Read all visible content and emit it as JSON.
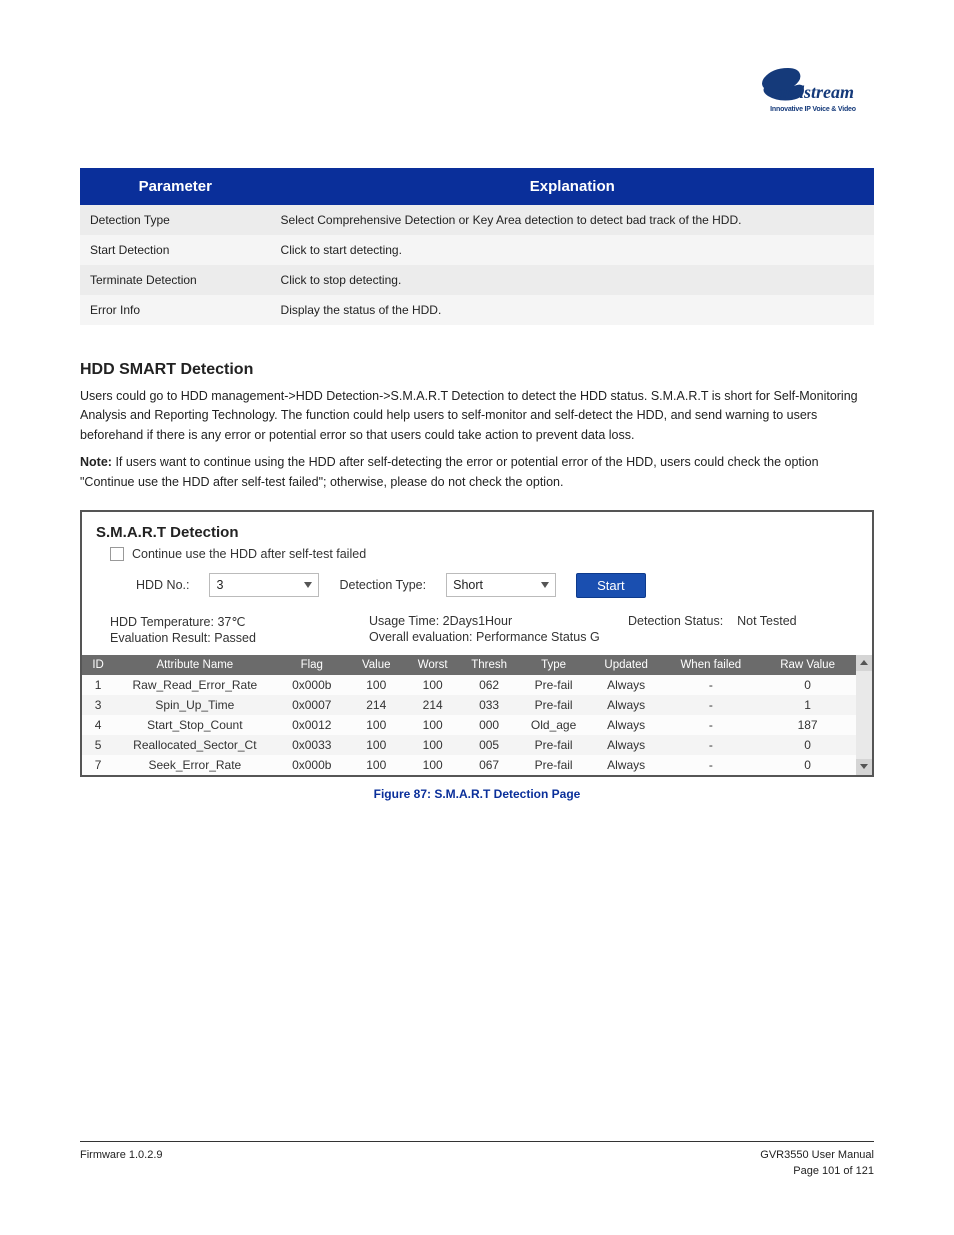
{
  "logo": {
    "tagline": "Innovative IP Voice & Video"
  },
  "param_table": {
    "headers": [
      "Parameter",
      "Explanation"
    ],
    "rows": [
      {
        "param": "Detection Type",
        "explanation": "Select Comprehensive Detection or Key Area detection to detect bad track of the HDD."
      },
      {
        "param": "Start Detection",
        "explanation": "Click to start detecting."
      },
      {
        "param": "Terminate Detection",
        "explanation": "Click to stop detecting."
      },
      {
        "param": "Error Info",
        "explanation": "Display the status of the HDD."
      }
    ]
  },
  "section": {
    "heading": "HDD SMART Detection",
    "paragraph": "Users could go to HDD management->HDD Detection->S.M.A.R.T Detection to detect the HDD status. S.M.A.R.T is short for Self-Monitoring Analysis and Reporting Technology. The function could help users to self-monitor and self-detect the HDD, and send warning to users beforehand if there is any error or potential error so that users could take action to prevent data loss.",
    "note_label": "Note:",
    "note_text": " If users want to continue using the HDD after self-detecting the error or potential error of the HDD, users could check the option \"Continue use the HDD after self-test failed\"; otherwise, please do not check the option."
  },
  "figure": {
    "title": "S.M.A.R.T Detection",
    "continue_label": "Continue use the HDD after self-test failed",
    "hdd_no_label": "HDD No.:",
    "hdd_no_value": "3",
    "detection_type_label": "Detection Type:",
    "detection_type_value": "Short",
    "start_label": "Start",
    "status": {
      "hdd_temp_label": "HDD Temperature: ",
      "hdd_temp_value": "37℃",
      "eval_result_label": "Evaluation Result: ",
      "eval_result_value": "Passed",
      "usage_time_label": "Usage Time: ",
      "usage_time_value": "2Days1Hour",
      "overall_eval_label": "Overall evaluation: ",
      "overall_eval_value": "Performance Status G",
      "detection_status_label": "Detection Status:",
      "detection_status_value": "Not Tested"
    },
    "table": {
      "headers": [
        "ID",
        "Attribute Name",
        "Flag",
        "Value",
        "Worst",
        "Thresh",
        "Type",
        "Updated",
        "When failed",
        "Raw Value"
      ],
      "rows": [
        [
          "1",
          "Raw_Read_Error_Rate",
          "0x000b",
          "100",
          "100",
          "062",
          "Pre-fail",
          "Always",
          "-",
          "0"
        ],
        [
          "3",
          "Spin_Up_Time",
          "0x0007",
          "214",
          "214",
          "033",
          "Pre-fail",
          "Always",
          "-",
          "1"
        ],
        [
          "4",
          "Start_Stop_Count",
          "0x0012",
          "100",
          "100",
          "000",
          "Old_age",
          "Always",
          "-",
          "187"
        ],
        [
          "5",
          "Reallocated_Sector_Ct",
          "0x0033",
          "100",
          "100",
          "005",
          "Pre-fail",
          "Always",
          "-",
          "0"
        ],
        [
          "7",
          "Seek_Error_Rate",
          "0x000b",
          "100",
          "100",
          "067",
          "Pre-fail",
          "Always",
          "-",
          "0"
        ]
      ]
    },
    "caption": "Figure 87: S.M.A.R.T Detection Page"
  },
  "footer": {
    "left_line1": "Firmware 1.0.2.9",
    "right_line1": "GVR3550 User Manual",
    "right_line2": "Page 101 of 121"
  }
}
